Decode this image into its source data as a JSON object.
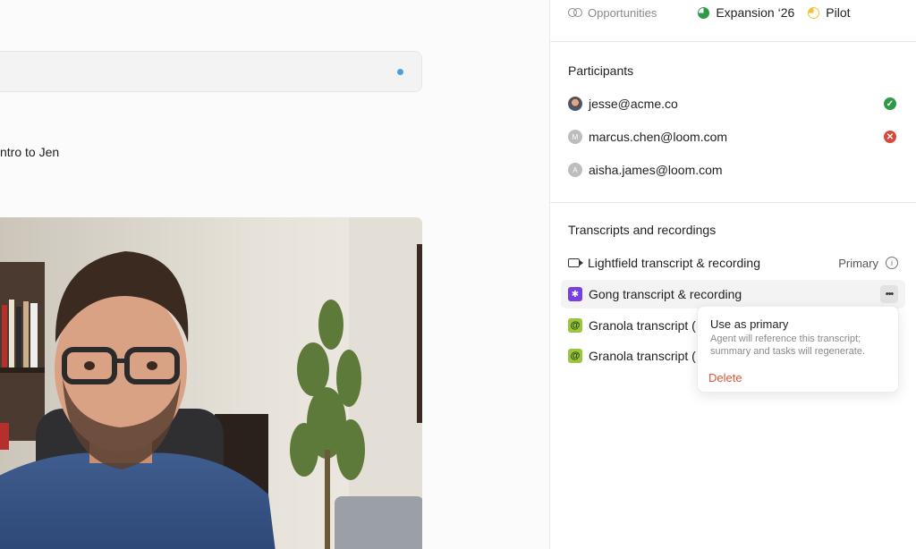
{
  "chat": {
    "intro_text": "ntro to Jen"
  },
  "header": {
    "opportunities_label": "Opportunities",
    "tags": [
      {
        "label": "Expansion ‘26",
        "color": "#2e9a45"
      },
      {
        "label": "Pilot",
        "color": "#f1c232"
      }
    ]
  },
  "participants": {
    "title": "Participants",
    "items": [
      {
        "email": "jesse@acme.co",
        "avatar": "photo",
        "status": "accepted",
        "status_glyph": "✓"
      },
      {
        "email": "marcus.chen@loom.com",
        "avatar": "M",
        "status": "declined",
        "status_glyph": "✕"
      },
      {
        "email": "aisha.james@loom.com",
        "avatar": "A",
        "status": "none",
        "status_glyph": ""
      }
    ]
  },
  "transcripts": {
    "title": "Transcripts and recordings",
    "items": [
      {
        "label": "Lightfield transcript & recording",
        "icon": "video-icon",
        "badge": "Primary"
      },
      {
        "label": "Gong transcript & recording",
        "icon": "gong-icon"
      },
      {
        "label": "Granola transcript (",
        "icon": "granola-icon"
      },
      {
        "label": "Granola transcript (",
        "icon": "granola-icon"
      }
    ]
  },
  "context_menu": {
    "use_primary_label": "Use as primary",
    "use_primary_desc": "Agent will reference this transcript; summary and tasks will regenerate.",
    "delete_label": "Delete"
  },
  "colors": {
    "accent_blue": "#4a9fe0",
    "gong_purple": "#7a3fe0",
    "granola_green": "#9bc53d",
    "success": "#2e9a45",
    "danger": "#d9483b"
  }
}
